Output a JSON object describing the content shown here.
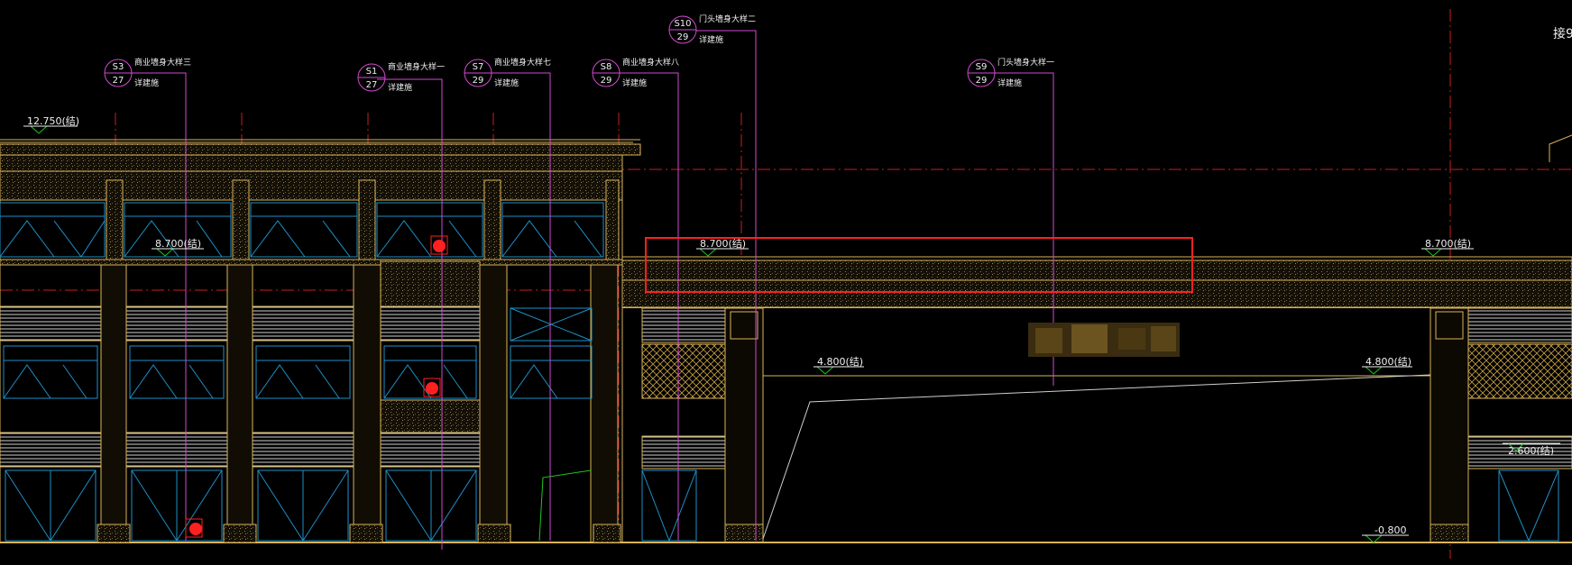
{
  "drawing": {
    "elevation_markers": [
      {
        "id": "lvl-12750",
        "text": "12.750(结)"
      },
      {
        "id": "lvl-8700-left",
        "text": "8.700(结)"
      },
      {
        "id": "lvl-8700-mid",
        "text": "8.700(结)"
      },
      {
        "id": "lvl-8700-right",
        "text": "8.700(结)"
      },
      {
        "id": "lvl-4800-left",
        "text": "4.800(结)"
      },
      {
        "id": "lvl-4800-right",
        "text": "4.800(结)"
      },
      {
        "id": "lvl-2600",
        "text": "2.600(结)"
      },
      {
        "id": "lvl-minus0800",
        "text": "-0.800"
      }
    ],
    "detail_callouts": [
      {
        "id": "S3",
        "num": "S3",
        "sheet": "27",
        "title": "商业墙身大样三",
        "note": "详建施"
      },
      {
        "id": "S1",
        "num": "S1",
        "sheet": "27",
        "title": "商业墙身大样一",
        "note": "详建施"
      },
      {
        "id": "S7",
        "num": "S7",
        "sheet": "29",
        "title": "商业墙身大样七",
        "note": "详建施"
      },
      {
        "id": "S8",
        "num": "S8",
        "sheet": "29",
        "title": "商业墙身大样八",
        "note": "详建施"
      },
      {
        "id": "S10",
        "num": "S10",
        "sheet": "29",
        "title": "门头墙身大样二",
        "note": "详建施"
      },
      {
        "id": "S9",
        "num": "S9",
        "sheet": "29",
        "title": "门头墙身大样一",
        "note": "详建施"
      }
    ],
    "corner_text": "接9",
    "colors": {
      "background": "#000000",
      "building": "#d9b45a",
      "glazing": "#1e90c8",
      "leader": "#d24ad2",
      "axis": "#c81e1e",
      "highlight": "#ff2020",
      "slope": "#cfcfcf",
      "level": "#f0f0f0"
    }
  }
}
